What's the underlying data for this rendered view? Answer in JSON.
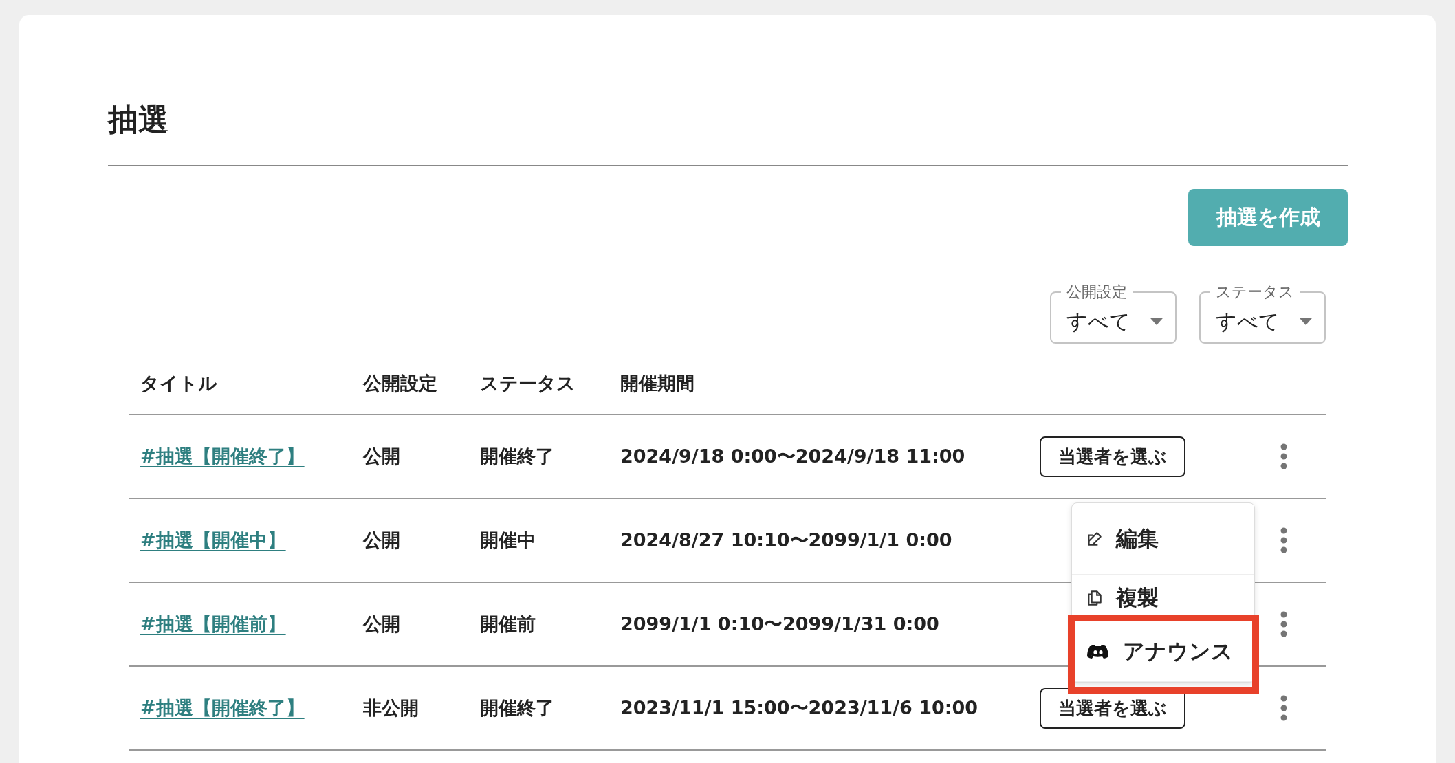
{
  "page": {
    "title": "抽選",
    "create_button": "抽選を作成"
  },
  "filters": [
    {
      "label": "公開設定",
      "value": "すべて"
    },
    {
      "label": "ステータス",
      "value": "すべて"
    }
  ],
  "table": {
    "columns": [
      "タイトル",
      "公開設定",
      "ステータス",
      "開催期間"
    ],
    "rows": [
      {
        "title": "#抽選【開催終了】",
        "visibility": "公開",
        "status": "開催終了",
        "period": "2024/9/18 0:00〜2024/9/18 11:00",
        "pick_button": "当選者を選ぶ"
      },
      {
        "title": "#抽選【開催中】",
        "visibility": "公開",
        "status": "開催中",
        "period": "2024/8/27 10:10〜2099/1/1 0:00"
      },
      {
        "title": "#抽選【開催前】",
        "visibility": "公開",
        "status": "開催前",
        "period": "2099/1/1 0:10〜2099/1/31 0:00"
      },
      {
        "title": "#抽選【開催終了】",
        "visibility": "非公開",
        "status": "開催終了",
        "period": "2023/11/1 15:00〜2023/11/6 10:00",
        "pick_button": "当選者を選ぶ"
      }
    ]
  },
  "menu": {
    "items": [
      {
        "kind": "edit",
        "label": "編集",
        "highlighted": false
      },
      {
        "kind": "copy",
        "label": "複製",
        "highlighted": false
      },
      {
        "kind": "announce",
        "label": "アナウンス",
        "highlighted": true
      }
    ]
  }
}
